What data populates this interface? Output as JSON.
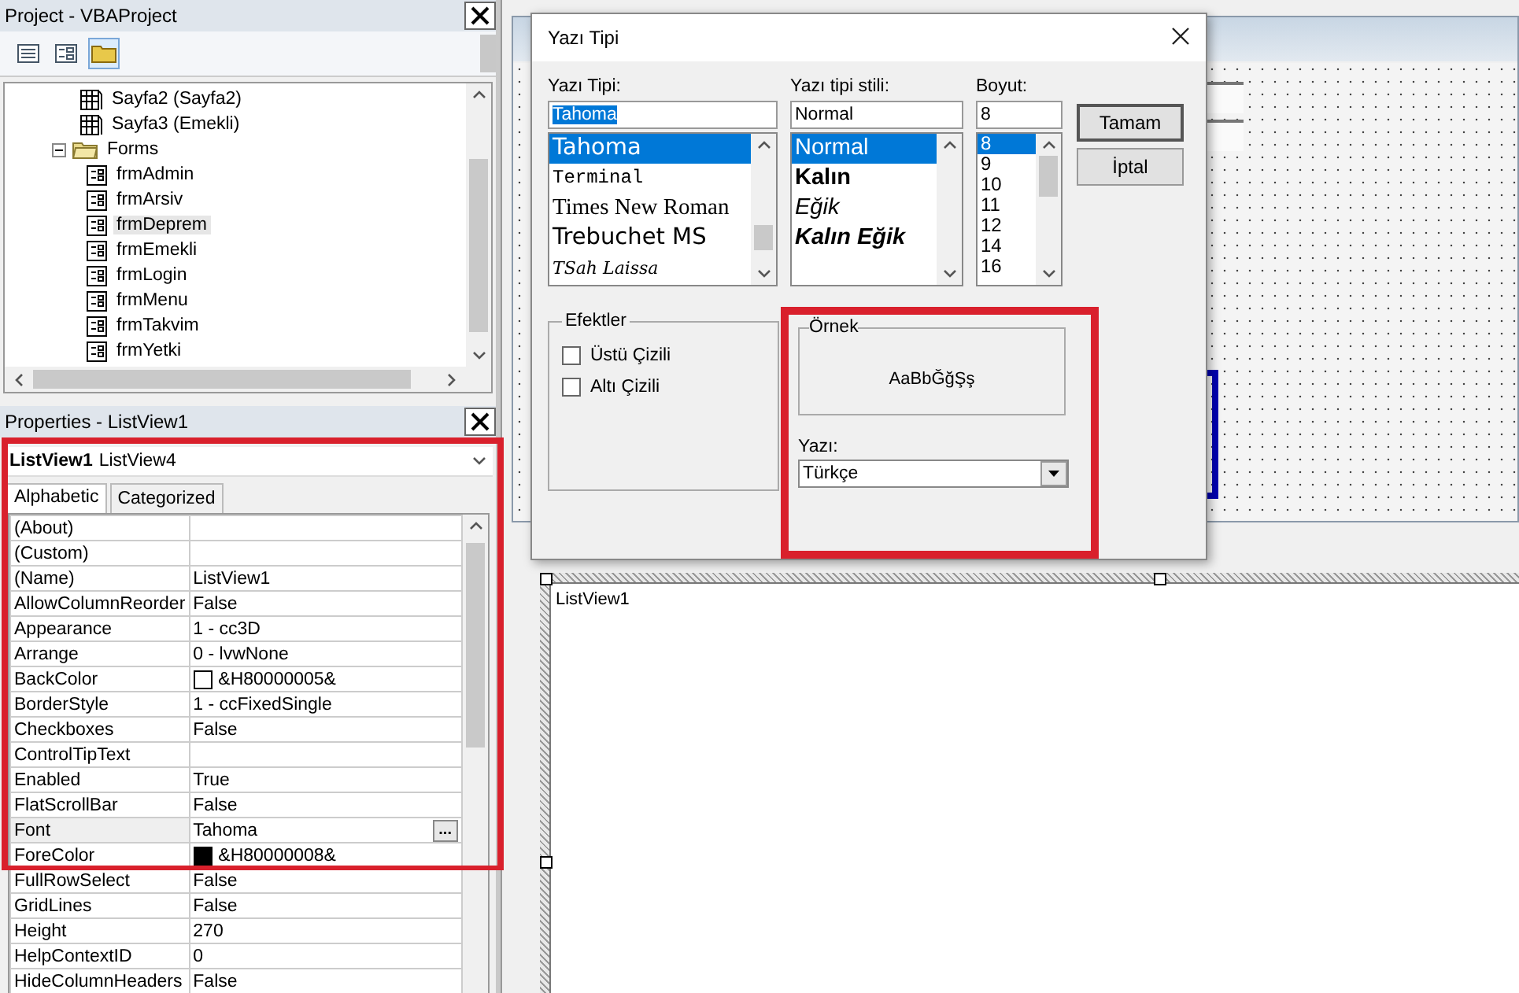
{
  "project": {
    "title": "Project - VBAProject",
    "tree": [
      {
        "label": "Sayfa2 (Sayfa2)",
        "kind": "sheet",
        "selected": false
      },
      {
        "label": "Sayfa3 (Emekli)",
        "kind": "sheet",
        "selected": false
      },
      {
        "label": "Forms",
        "kind": "folder",
        "selected": false,
        "expanded": true,
        "children": [
          {
            "label": "frmAdmin",
            "kind": "form",
            "selected": false
          },
          {
            "label": "frmArsiv",
            "kind": "form",
            "selected": false
          },
          {
            "label": "frmDeprem",
            "kind": "form",
            "selected": true
          },
          {
            "label": "frmEmekli",
            "kind": "form",
            "selected": false
          },
          {
            "label": "frmLogin",
            "kind": "form",
            "selected": false
          },
          {
            "label": "frmMenu",
            "kind": "form",
            "selected": false
          },
          {
            "label": "frmTakvim",
            "kind": "form",
            "selected": false
          },
          {
            "label": "frmYetki",
            "kind": "form",
            "selected": false
          }
        ]
      }
    ]
  },
  "properties": {
    "title": "Properties - ListView1",
    "object_name": "ListView1",
    "object_type": "ListView4",
    "tabs": [
      {
        "label": "Alphabetic",
        "selected": true
      },
      {
        "label": "Categorized",
        "selected": false
      }
    ],
    "rows": [
      {
        "name": "(About)",
        "selected": false
      },
      {
        "name": "(Custom)",
        "selected": false
      },
      {
        "name": "(Name)",
        "value": "ListView1",
        "selected": false
      },
      {
        "name": "AllowColumnReorder",
        "value": "False",
        "selected": false
      },
      {
        "name": "Appearance",
        "value": "1 - cc3D",
        "selected": false
      },
      {
        "name": "Arrange",
        "value": "0 - lvwNone",
        "selected": false
      },
      {
        "name": "BackColor",
        "value": "&H80000005&",
        "color": "#ffffff",
        "selected": false
      },
      {
        "name": "BorderStyle",
        "value": "1 - ccFixedSingle",
        "selected": false
      },
      {
        "name": "Checkboxes",
        "value": "False",
        "selected": false
      },
      {
        "name": "ControlTipText",
        "selected": false
      },
      {
        "name": "Enabled",
        "value": "True",
        "selected": false
      },
      {
        "name": "FlatScrollBar",
        "value": "False",
        "selected": false
      },
      {
        "name": "Font",
        "value": "Tahoma",
        "button": "...",
        "selected": true
      },
      {
        "name": "ForeColor",
        "value": "&H80000008&",
        "color": "#000000",
        "selected": false
      },
      {
        "name": "FullRowSelect",
        "value": "False",
        "selected": false
      },
      {
        "name": "GridLines",
        "value": "False",
        "selected": false
      },
      {
        "name": "Height",
        "value": "270",
        "selected": false
      },
      {
        "name": "HelpContextID",
        "value": "0",
        "selected": false
      },
      {
        "name": "HideColumnHeaders",
        "value": "False",
        "selected": false
      }
    ]
  },
  "designer": {
    "listview_label": "ListView1"
  },
  "dialog": {
    "title": "Yazı Tipi",
    "font": {
      "label": "Yazı Tipi:",
      "value": "Tahoma",
      "items": [
        {
          "label": "Tahoma",
          "kind": "sans",
          "selected": true
        },
        {
          "label": "Terminal",
          "kind": "mono",
          "selected": false
        },
        {
          "label": "Times New Roman",
          "kind": "serif",
          "selected": false
        },
        {
          "label": "Trebuchet MS",
          "kind": "sans",
          "selected": false
        },
        {
          "label": "TSah Laissa",
          "kind": "script",
          "selected": false
        }
      ]
    },
    "style": {
      "label": "Yazı tipi stili:",
      "value": "Normal",
      "items": [
        {
          "label": "Normal",
          "kind": "regular",
          "selected": true
        },
        {
          "label": "Kalın",
          "kind": "bold",
          "selected": false
        },
        {
          "label": "Eğik",
          "kind": "italic",
          "selected": false
        },
        {
          "label": "Kalın Eğik",
          "kind": "bold-italic",
          "selected": false
        }
      ]
    },
    "size": {
      "label": "Boyut:",
      "value": "8",
      "items": [
        {
          "label": "8",
          "selected": true
        },
        {
          "label": "9",
          "selected": false
        },
        {
          "label": "10",
          "selected": false
        },
        {
          "label": "11",
          "selected": false
        },
        {
          "label": "12",
          "selected": false
        },
        {
          "label": "14",
          "selected": false
        },
        {
          "label": "16",
          "selected": false
        }
      ]
    },
    "buttons": [
      "Tamam",
      "İptal"
    ],
    "effects": {
      "title": "Efektler",
      "options": [
        {
          "label": "Üstü Çizili",
          "checked": false
        },
        {
          "label": "Altı Çizili",
          "checked": false
        }
      ]
    },
    "sample": {
      "title": "Örnek",
      "text": "AaBbĞğŞş"
    },
    "script": {
      "label": "Yazı:",
      "value": "Türkçe"
    }
  }
}
